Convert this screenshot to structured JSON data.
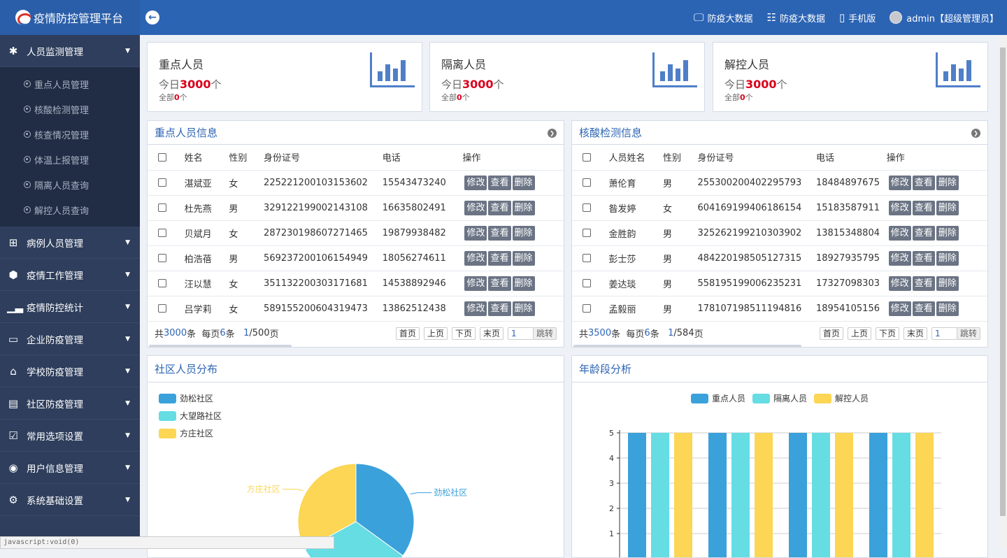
{
  "header": {
    "title": "疫情防控管理平台",
    "nav": [
      {
        "icon": "monitor-icon",
        "label": "防疫大数据"
      },
      {
        "icon": "sitemap-icon",
        "label": "防疫大数据"
      },
      {
        "icon": "mobile-icon",
        "label": "手机版"
      }
    ],
    "user": "admin【超级管理员】"
  },
  "sidebar": {
    "items": [
      {
        "icon": "asterisk-icon",
        "label": "人员监测管理",
        "expanded": true,
        "children": [
          "重点人员管理",
          "核酸检测管理",
          "核查情况管理",
          "体温上报管理",
          "隔离人员查询",
          "解控人员查询"
        ]
      },
      {
        "icon": "plus-square-icon",
        "label": "病例人员管理"
      },
      {
        "icon": "cube-icon",
        "label": "疫情工作管理"
      },
      {
        "icon": "bar-chart-icon",
        "label": "疫情防控统计"
      },
      {
        "icon": "inbox-icon",
        "label": "企业防疫管理"
      },
      {
        "icon": "bank-icon",
        "label": "学校防疫管理"
      },
      {
        "icon": "id-card-icon",
        "label": "社区防疫管理"
      },
      {
        "icon": "check-square-icon",
        "label": "常用选项设置"
      },
      {
        "icon": "user-circle-icon",
        "label": "用户信息管理"
      },
      {
        "icon": "cog-icon",
        "label": "系统基础设置"
      }
    ]
  },
  "stats": [
    {
      "title": "重点人员",
      "today_prefix": "今日",
      "today_value": "3000",
      "today_unit": "个",
      "all_prefix": "全部",
      "all_value": "0",
      "all_unit": "个"
    },
    {
      "title": "隔离人员",
      "today_prefix": "今日",
      "today_value": "3000",
      "today_unit": "个",
      "all_prefix": "全部",
      "all_value": "0",
      "all_unit": "个"
    },
    {
      "title": "解控人员",
      "today_prefix": "今日",
      "today_value": "3000",
      "today_unit": "个",
      "all_prefix": "全部",
      "all_value": "0",
      "all_unit": "个"
    }
  ],
  "actions": {
    "edit": "修改",
    "view": "查看",
    "delete": "删除"
  },
  "pager_labels": {
    "total_prefix": "共",
    "total_suffix": "条",
    "per_prefix": "每页",
    "per_suffix": "条",
    "page_suffix": "页",
    "first": "首页",
    "prev": "上页",
    "next": "下页",
    "last": "末页",
    "go": "跳转"
  },
  "key_persons": {
    "title": "重点人员信息",
    "columns": [
      "姓名",
      "性别",
      "身份证号",
      "电话",
      "操作"
    ],
    "rows": [
      [
        "湛斌亚",
        "女",
        "225221200103153602",
        "15543473240"
      ],
      [
        "杜先燕",
        "男",
        "329122199002143108",
        "16635802491"
      ],
      [
        "贝斌月",
        "女",
        "287230198607271465",
        "19879938482"
      ],
      [
        "柏浩蓓",
        "男",
        "569237200106154949",
        "18056274611"
      ],
      [
        "汪以慧",
        "女",
        "351132200303171681",
        "14538892946"
      ],
      [
        "吕学莉",
        "女",
        "589155200604319473",
        "13862512438"
      ]
    ],
    "pager": {
      "total": "3000",
      "per": "6",
      "page": "1",
      "pages": "/500",
      "input": "1"
    }
  },
  "nucleic": {
    "title": "核酸检测信息",
    "columns": [
      "人员姓名",
      "性别",
      "身份证号",
      "电话",
      "操作"
    ],
    "rows": [
      [
        "萧伦育",
        "男",
        "255300200402295793",
        "18484897675"
      ],
      [
        "昝发婷",
        "女",
        "604169199406186154",
        "15183587911"
      ],
      [
        "金胜韵",
        "男",
        "325262199210303902",
        "13815348804"
      ],
      [
        "彭士莎",
        "男",
        "484220198505127315",
        "18927935795"
      ],
      [
        "姜达琰",
        "男",
        "558195199006235231",
        "17327098303"
      ],
      [
        "孟毅丽",
        "男",
        "178107198511194816",
        "18954105156"
      ]
    ],
    "pager": {
      "total": "3500",
      "per": "6",
      "page": "1",
      "pages": "/584",
      "input": "1"
    }
  },
  "community": {
    "title": "社区人员分布"
  },
  "age": {
    "title": "年龄段分析"
  },
  "chart_data": [
    {
      "type": "pie",
      "title": "社区人员分布",
      "labels": [
        "劲松社区",
        "大望路社区",
        "方庄社区"
      ],
      "values": [
        35,
        32,
        33
      ],
      "colors": [
        "#3ba1da",
        "#65dde3",
        "#fcd654"
      ],
      "legend": "top-left"
    },
    {
      "type": "bar",
      "title": "年龄段分析",
      "series": [
        {
          "name": "重点人员",
          "color": "#3ba1da",
          "values": [
            5,
            5,
            5,
            5
          ]
        },
        {
          "name": "隔离人员",
          "color": "#65dde3",
          "values": [
            5,
            5,
            5,
            5
          ]
        },
        {
          "name": "解控人员",
          "color": "#fcd654",
          "values": [
            5,
            5,
            5,
            5
          ]
        }
      ],
      "categories": [
        "",
        "",
        "",
        ""
      ],
      "yticks": [
        1,
        2,
        3,
        4,
        5
      ],
      "ylim": [
        0,
        5
      ],
      "legend": "top-center",
      "grid": true
    }
  ],
  "statusbar": "javascript:void(0)"
}
